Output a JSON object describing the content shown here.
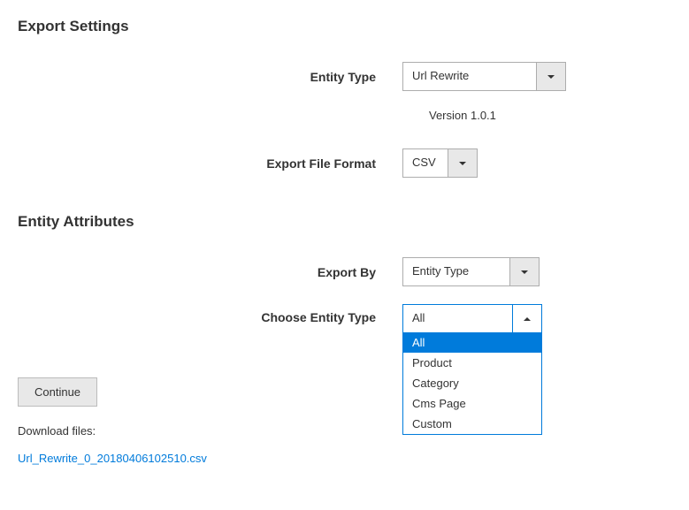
{
  "sections": {
    "export_settings_title": "Export Settings",
    "entity_attributes_title": "Entity Attributes"
  },
  "fields": {
    "entity_type": {
      "label": "Entity Type",
      "value": "Url Rewrite"
    },
    "version": "Version 1.0.1",
    "export_file_format": {
      "label": "Export File Format",
      "value": "CSV"
    },
    "export_by": {
      "label": "Export By",
      "value": "Entity Type"
    },
    "choose_entity_type": {
      "label": "Choose Entity Type",
      "value": "All",
      "options": [
        "All",
        "Product",
        "Category",
        "Cms Page",
        "Custom"
      ]
    }
  },
  "buttons": {
    "continue": "Continue"
  },
  "download": {
    "label": "Download files:",
    "filename": "Url_Rewrite_0_20180406102510.csv"
  }
}
